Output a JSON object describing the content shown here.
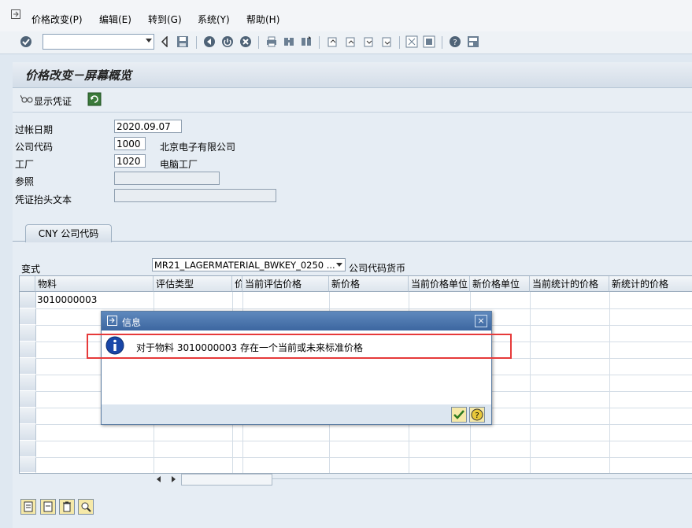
{
  "menu": {
    "items": [
      "价格改变(P)",
      "编辑(E)",
      "转到(G)",
      "系统(Y)",
      "帮助(H)"
    ]
  },
  "toolbar": {
    "command_value": "",
    "icons": [
      "enter-icon",
      "back-icon",
      "save-icon",
      "back-nav-icon",
      "exit-icon",
      "cancel-icon",
      "print-icon",
      "find-icon",
      "find-next-icon",
      "first-page-icon",
      "prev-page-icon",
      "next-page-icon",
      "last-page-icon",
      "create-session-icon",
      "shortcut-icon",
      "help-icon",
      "layout-icon"
    ]
  },
  "screen": {
    "title": "价格改变－屏幕概览"
  },
  "app_toolbar": {
    "show_doc_label": "显示凭证"
  },
  "header_fields": {
    "posting_date_label": "过帐日期",
    "posting_date_value": "2020.09.07",
    "company_code_label": "公司代码",
    "company_code_value": "1000",
    "company_name": "北京电子有限公司",
    "plant_label": "工厂",
    "plant_value": "1020",
    "plant_name": "电脑工厂",
    "reference_label": "参照",
    "reference_value": "",
    "doc_header_text_label": "凭证抬头文本",
    "doc_header_text_value": ""
  },
  "tabs": [
    {
      "label": "CNY 公司代码"
    }
  ],
  "variant": {
    "label": "变式",
    "value": "MR21_LAGERMATERIAL_BWKEY_0250 ...",
    "currency_label": "公司代码货币"
  },
  "table": {
    "columns": [
      "物料",
      "评估类型",
      "价",
      "当前评估价格",
      "新价格",
      "当前价格单位",
      "新价格单位",
      "当前统计的价格",
      "新统计的价格"
    ],
    "rows": [
      {
        "material": "3010000003"
      }
    ]
  },
  "dialog": {
    "title": "信息",
    "message": "对于物料 3010000003 存在一个当前或未来标准价格",
    "close": "×"
  },
  "colors": {
    "dialog_title": "#3c66a0",
    "highlight": "#e63a3a",
    "background": "#dfe8f1"
  }
}
